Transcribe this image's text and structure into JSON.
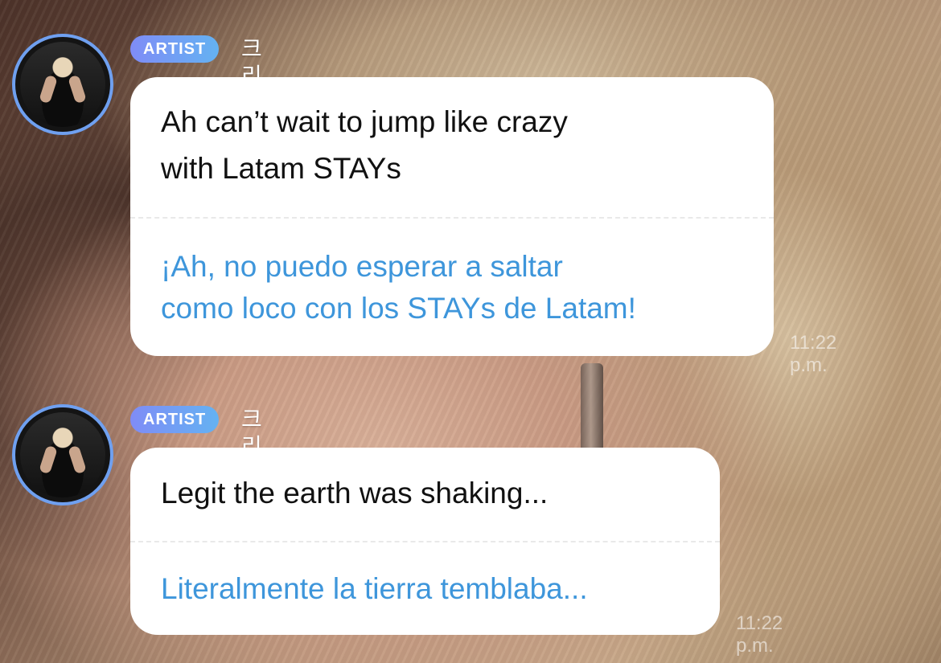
{
  "messages": [
    {
      "badge": "ARTIST",
      "sender": "크리스",
      "original": "Ah can’t wait to jump like crazy\nwith Latam STAYs",
      "translation": "¡Ah, no puedo esperar a saltar\ncomo loco con los STAYs de Latam!",
      "time": "11:22 p.m."
    },
    {
      "badge": "ARTIST",
      "sender": "크리스",
      "original": "Legit the earth was shaking...",
      "translation": "Literalmente la tierra temblaba...",
      "time": "11:22 p.m."
    }
  ],
  "colors": {
    "translation_text": "#3e96db",
    "avatar_ring": "#6fa0f0",
    "badge_gradient_start": "#7f8cf6",
    "badge_gradient_end": "#64b2f2"
  }
}
